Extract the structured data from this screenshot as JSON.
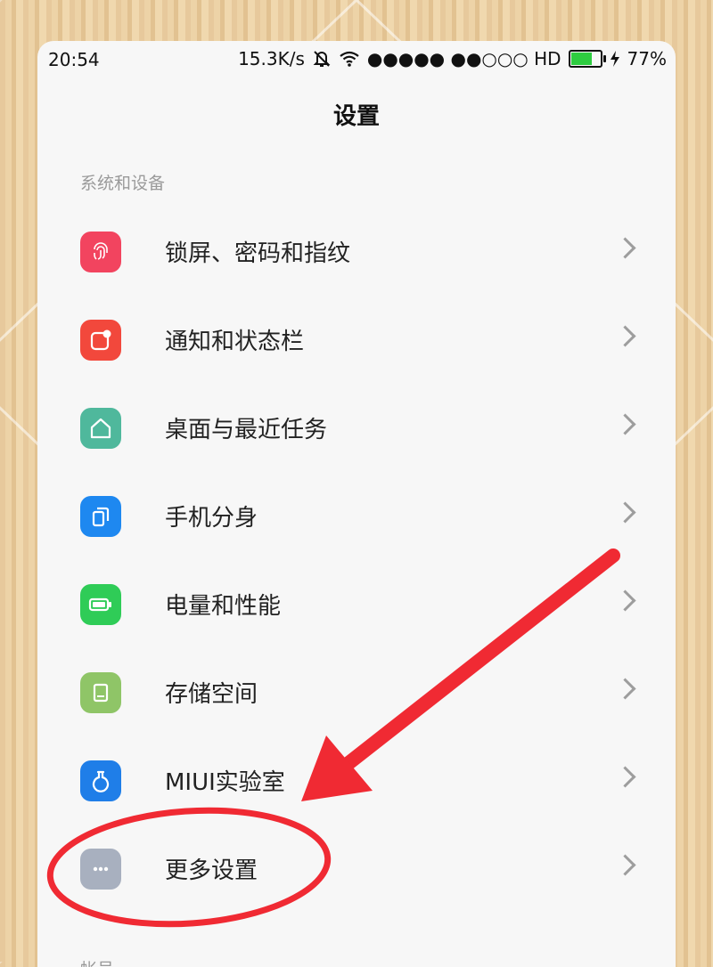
{
  "status_bar": {
    "time": "20:54",
    "speed": "15.3K/s",
    "signal": "●●●●● ●●○○○ HD",
    "battery": "77%",
    "battery_level": 0.77
  },
  "header": {
    "title": "设置"
  },
  "sections": [
    {
      "label": "系统和设备",
      "items": [
        {
          "label": "锁屏、密码和指纹",
          "icon": "fingerprint-icon",
          "color": "#f2445f"
        },
        {
          "label": "通知和状态栏",
          "icon": "notification-icon",
          "color": "#f2483c"
        },
        {
          "label": "桌面与最近任务",
          "icon": "home-icon",
          "color": "#4fb89c"
        },
        {
          "label": "手机分身",
          "icon": "dual-space-icon",
          "color": "#1e88f0"
        },
        {
          "label": "电量和性能",
          "icon": "battery-icon",
          "color": "#2fcc57"
        },
        {
          "label": "存储空间",
          "icon": "storage-icon",
          "color": "#8fc567"
        },
        {
          "label": "MIUI实验室",
          "icon": "flask-icon",
          "color": "#1f7ee8"
        },
        {
          "label": "更多设置",
          "icon": "more-icon",
          "color": "#a8b0bf"
        }
      ]
    },
    {
      "label": "帐号"
    }
  ],
  "annotation": {
    "color": "#f02a33"
  }
}
